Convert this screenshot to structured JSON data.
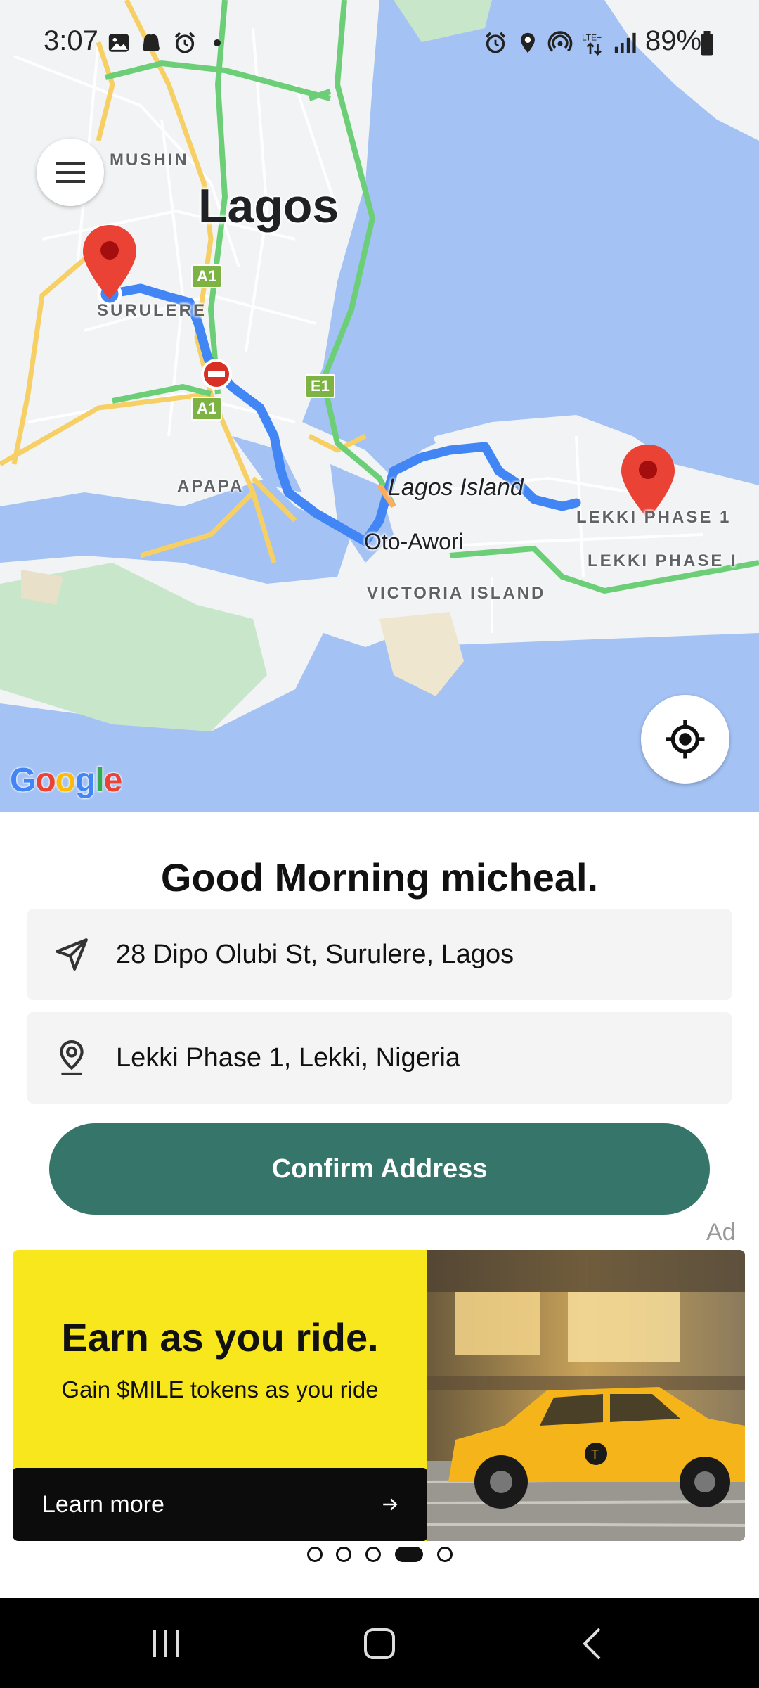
{
  "status_bar": {
    "time": "3:07",
    "battery": "89%",
    "icons": [
      "image-icon",
      "notification-icon",
      "alarm-icon",
      "dot-icon",
      "alarm-icon",
      "location-icon",
      "hotspot-icon",
      "lte-icon",
      "signal-icon",
      "battery-icon"
    ]
  },
  "map": {
    "city_label": "Lagos",
    "labels": {
      "mushin": "MUSHIN",
      "surulere": "SURULERE",
      "apapa": "APAPA",
      "lagos_island": "Lagos Island",
      "oto_awori": "Oto-Awori",
      "victoria_island": "VICTORIA ISLAND",
      "lekki_phase_1": "LEKKI PHASE 1",
      "lekki_phase_i": "LEKKI PHASE I"
    },
    "road_shields": {
      "a1_top": "A1",
      "a1_bottom": "A1",
      "e1": "E1"
    },
    "route_color": "#4285f4",
    "pin_color": "#ea4335",
    "attribution": "Google"
  },
  "greeting": "Good Morning micheal.",
  "pickup": {
    "address": "28 Dipo Olubi St, Surulere, Lagos",
    "icon": "navigation-arrow-icon"
  },
  "dropoff": {
    "address": "Lekki Phase 1, Lekki, Nigeria",
    "icon": "location-pin-icon"
  },
  "confirm_button": {
    "label": "Confirm Address",
    "color": "#36756a"
  },
  "ad": {
    "label": "Ad",
    "headline": "Earn as you ride.",
    "subtext": "Gain $MILE tokens as you ride",
    "cta": "Learn more",
    "accent": "#f8e71c"
  },
  "pager": {
    "count": 5,
    "active_index": 3
  },
  "nav_bar": {
    "buttons": [
      "recent-apps-icon",
      "home-icon",
      "back-icon"
    ]
  }
}
